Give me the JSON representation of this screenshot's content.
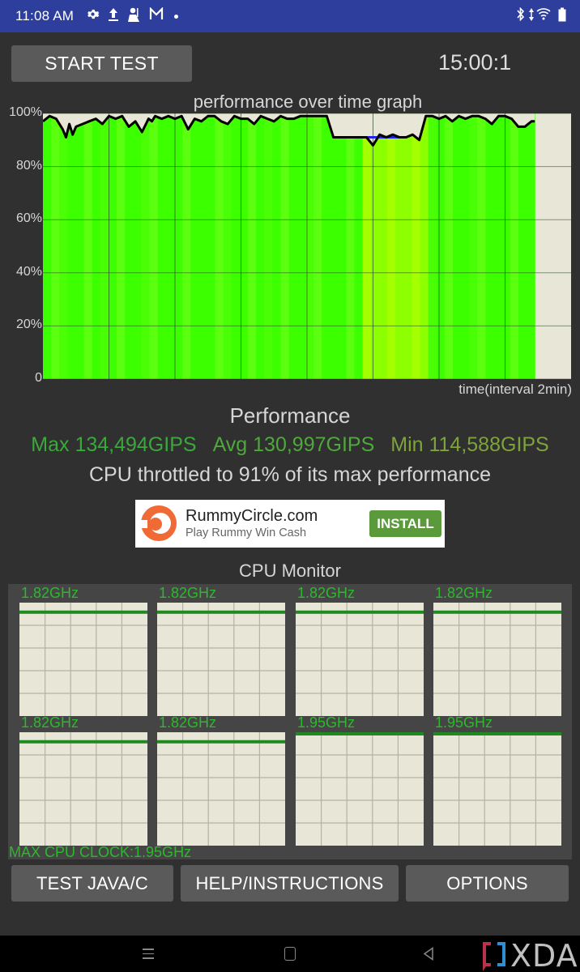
{
  "status_bar": {
    "time": "11:08 AM",
    "left_icons": [
      "gear-icon",
      "upload-icon",
      "user-badge-icon",
      "gmail-icon",
      "notification-dot-icon"
    ],
    "right_icons": [
      "bluetooth-icon",
      "data-arrows-icon",
      "wifi-icon",
      "battery-icon"
    ],
    "bg_color": "#2e3e9c"
  },
  "header": {
    "start_button": "START TEST",
    "timer": "15:00:1"
  },
  "graph": {
    "title": "performance over time graph",
    "x_label": "time(interval 2min)"
  },
  "chart_data": {
    "type": "area",
    "title": "performance over time graph",
    "xlabel": "time(interval 2min)",
    "ylabel": "",
    "y_ticks": [
      "100%",
      "80%",
      "60%",
      "40%",
      "20%",
      "0"
    ],
    "ylim": [
      0,
      100
    ],
    "xlim_minutes": [
      0,
      16
    ],
    "x_grid_interval_minutes": 2,
    "grid": true,
    "colors": {
      "fill_full": "#3cff00",
      "fill_throttled": "#84ff00",
      "line": "#000000",
      "throttle_line": "#2222ee",
      "background": "#e8e6d6"
    },
    "series": [
      {
        "name": "performance_percent",
        "x_minutes": [
          0,
          0.2,
          0.4,
          0.6,
          0.7,
          0.8,
          0.9,
          1.0,
          1.2,
          1.4,
          1.6,
          1.8,
          2.0,
          2.2,
          2.4,
          2.6,
          2.8,
          3.0,
          3.2,
          3.3,
          3.4,
          3.6,
          3.8,
          4.0,
          4.2,
          4.4,
          4.6,
          4.8,
          5.0,
          5.2,
          5.4,
          5.6,
          5.8,
          6.0,
          6.2,
          6.4,
          6.6,
          6.8,
          7.0,
          7.2,
          7.4,
          7.6,
          7.8,
          8.0,
          8.2,
          8.4,
          8.6,
          8.8,
          9.0,
          9.2,
          9.4,
          9.6,
          9.8,
          10.0,
          10.2,
          10.4,
          10.6,
          10.8,
          11.0,
          11.2,
          11.4,
          11.6,
          11.8,
          12.0,
          12.2,
          12.4,
          12.6,
          12.8,
          13.0,
          13.2,
          13.4,
          13.6,
          13.8,
          14.0,
          14.2,
          14.4,
          14.6,
          14.8,
          14.9
        ],
        "values": [
          97,
          99,
          98,
          94,
          91,
          96,
          92,
          95,
          96,
          97,
          98,
          96,
          99,
          98,
          99,
          95,
          97,
          93,
          98,
          97,
          99,
          98,
          99,
          98,
          99,
          94,
          98,
          97,
          99,
          99,
          97,
          96,
          99,
          98,
          98,
          96,
          99,
          98,
          97,
          99,
          98,
          98,
          99,
          99,
          99,
          99,
          99,
          91,
          91,
          91,
          91,
          91,
          91,
          88,
          92,
          91,
          92,
          91,
          91,
          92,
          90,
          99,
          99,
          98,
          99,
          97,
          99,
          98,
          99,
          99,
          98,
          96,
          99,
          99,
          98,
          95,
          95,
          97,
          97
        ]
      }
    ],
    "throttle_segment_minutes": [
      9.6,
      11.7
    ],
    "data_end_minutes": 14.9
  },
  "performance": {
    "title": "Performance",
    "max": "Max 134,494GIPS",
    "avg": "Avg 130,997GIPS",
    "min": "Min 114,588GIPS",
    "throttle_text": "CPU throttled to 91% of its max performance"
  },
  "ad": {
    "title": "RummyCircle.com",
    "subtitle": "Play Rummy Win Cash",
    "install": "INSTALL"
  },
  "cpu_monitor": {
    "title": "CPU Monitor",
    "cores": [
      {
        "label": "1.82GHz",
        "level": 0.93
      },
      {
        "label": "1.82GHz",
        "level": 0.93
      },
      {
        "label": "1.82GHz",
        "level": 0.93
      },
      {
        "label": "1.82GHz",
        "level": 0.93
      },
      {
        "label": "1.82GHz",
        "level": 0.93
      },
      {
        "label": "1.82GHz",
        "level": 0.93
      },
      {
        "label": "1.95GHz",
        "level": 1.0
      },
      {
        "label": "1.95GHz",
        "level": 1.0
      }
    ],
    "max_clock": "MAX CPU CLOCK:1.95GHz"
  },
  "buttons": {
    "test_java": "TEST JAVA/C",
    "help": "HELP/INSTRUCTIONS",
    "options": "OPTIONS"
  },
  "watermark": "XDA"
}
